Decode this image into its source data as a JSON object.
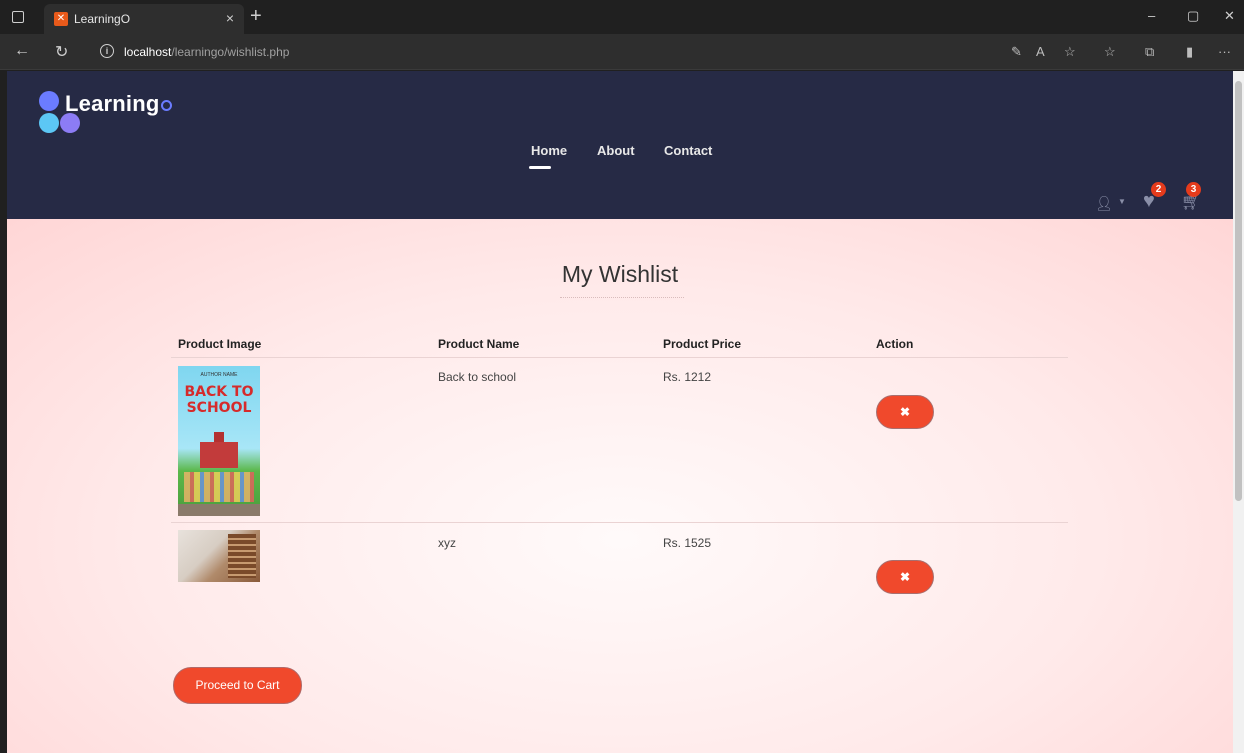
{
  "browser": {
    "tab_title": "LearningO",
    "tab_close": "×",
    "new_tab": "+",
    "url_host": "localhost",
    "url_path": "/learningo/wishlist.php",
    "win_minimize": "–",
    "win_restore": "▢",
    "win_close": "✕",
    "back": "←",
    "refresh": "↻",
    "more": "···"
  },
  "site": {
    "logo_text": "Learning",
    "nav": [
      "Home",
      "About",
      "Contact"
    ],
    "wishlist_count": "2",
    "cart_count": "3"
  },
  "wishlist": {
    "title": "My Wishlist",
    "headers": {
      "image": "Product Image",
      "name": "Product Name",
      "price": "Product Price",
      "action": "Action"
    },
    "items": [
      {
        "name": "Back to school",
        "price": "Rs. 1212",
        "cover_author": "AUTHOR NAME",
        "cover_title": "BACK TO SCHOOL"
      },
      {
        "name": "xyz",
        "price": "Rs. 1525"
      }
    ],
    "remove_label": "✖",
    "proceed_label": "Proceed to Cart"
  }
}
